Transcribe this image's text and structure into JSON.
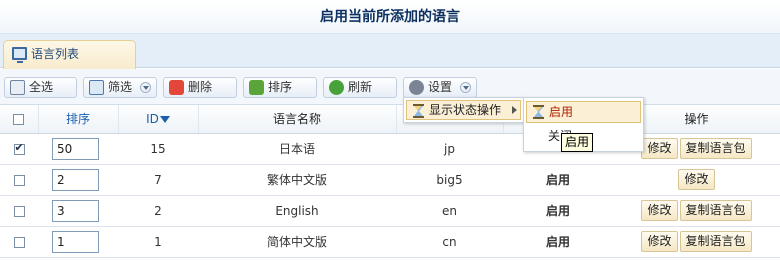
{
  "page_title": "启用当前所添加的语言",
  "tab_label": "语言列表",
  "toolbar": {
    "select_all": "全选",
    "filter": "筛选",
    "delete": "删除",
    "sort": "排序",
    "refresh": "刷新",
    "settings": "设置"
  },
  "menu": {
    "show_status": "显示状态操作",
    "enable": "启用",
    "disable": "关闭"
  },
  "tooltip": "启用",
  "columns": {
    "order": "排序",
    "id": "ID",
    "name": "语言名称",
    "action": "操作"
  },
  "rows": [
    {
      "order": "50",
      "id": "15",
      "name": "日本语",
      "code": "jp",
      "status": "",
      "checked": true,
      "edit": "修改",
      "copy": "复制语言包"
    },
    {
      "order": "2",
      "id": "7",
      "name": "繁体中文版",
      "code": "big5",
      "status": "启用",
      "checked": false,
      "edit": "修改",
      "copy": ""
    },
    {
      "order": "3",
      "id": "2",
      "name": "English",
      "code": "en",
      "status": "启用",
      "checked": false,
      "edit": "修改",
      "copy": "复制语言包"
    },
    {
      "order": "1",
      "id": "1",
      "name": "简体中文版",
      "code": "cn",
      "status": "启用",
      "checked": false,
      "edit": "修改",
      "copy": "复制语言包"
    }
  ]
}
